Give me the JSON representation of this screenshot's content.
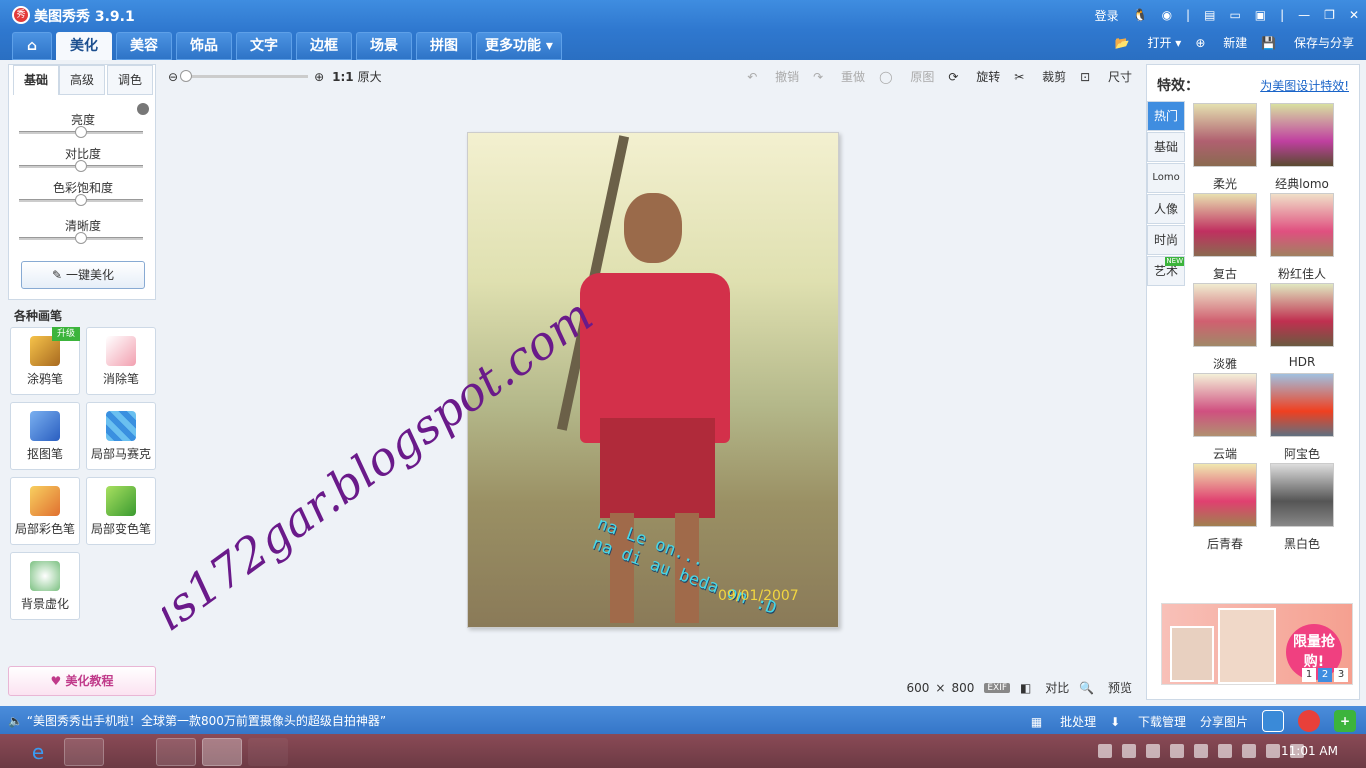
{
  "app": {
    "title": "美图秀秀 3.9.1",
    "logo_text": "秀"
  },
  "titlebar": {
    "login": "登录",
    "icons": [
      "qq-icon",
      "weibo-icon",
      "skin-icon",
      "feedback-icon",
      "settings-icon",
      "minimize-icon",
      "restore-icon",
      "close-icon"
    ]
  },
  "tabs": [
    {
      "label": "",
      "name": "home"
    },
    {
      "label": "美化"
    },
    {
      "label": "美容"
    },
    {
      "label": "饰品"
    },
    {
      "label": "文字"
    },
    {
      "label": "边框"
    },
    {
      "label": "场景"
    },
    {
      "label": "拼图"
    },
    {
      "label": "更多功能"
    }
  ],
  "file_actions": {
    "open": "打开",
    "new": "新建",
    "save": "保存与分享"
  },
  "left": {
    "subtabs": [
      "基础",
      "高级",
      "调色"
    ],
    "sliders": [
      "亮度",
      "对比度",
      "色彩饱和度",
      "清晰度"
    ],
    "one_key": "一键美化",
    "pens_title": "各种画笔",
    "pens": [
      {
        "label": "涂鸦笔",
        "badge": "升级"
      },
      {
        "label": "消除笔"
      },
      {
        "label": "抠图笔"
      },
      {
        "label": "局部马赛克"
      },
      {
        "label": "局部彩色笔"
      },
      {
        "label": "局部变色笔"
      },
      {
        "label": "背景虚化"
      }
    ],
    "tutorial": "美化教程"
  },
  "toolbar": {
    "zoom_ratio": "1:1",
    "original_size": "原大",
    "undo": "撤销",
    "redo": "重做",
    "original": "原图",
    "rotate": "旋转",
    "crop": "裁剪",
    "resize": "尺寸"
  },
  "photo": {
    "text1": "na Le on...",
    "text2": "na di au beda on :D",
    "date": "09/01/2007",
    "watermark": "ris172gar.blogspot.com"
  },
  "image_info": {
    "width": "600",
    "times": "×",
    "height": "800",
    "exif": "EXIF",
    "compare": "对比",
    "preview": "预览"
  },
  "right": {
    "header": "特效：",
    "link": "为美图设计特效!",
    "vtabs": [
      "热门",
      "基础",
      "Lomo",
      "人像",
      "时尚",
      "艺术"
    ],
    "new_badge": "NEW",
    "effects": [
      "柔光",
      "经典lomo",
      "复古",
      "粉红佳人",
      "淡雅",
      "HDR",
      "云端",
      "阿宝色",
      "后青春",
      "黑白色"
    ],
    "ad_text": "限量抢购!",
    "ad_pages": [
      "1",
      "2",
      "3"
    ]
  },
  "status": {
    "news": "“美图秀秀出手机啦！全球第一款800万前置摄像头的超级自拍神器”",
    "batch": "批处理",
    "download": "下载管理",
    "share": "分享图片"
  },
  "taskbar": {
    "clock": "11:01 AM"
  }
}
